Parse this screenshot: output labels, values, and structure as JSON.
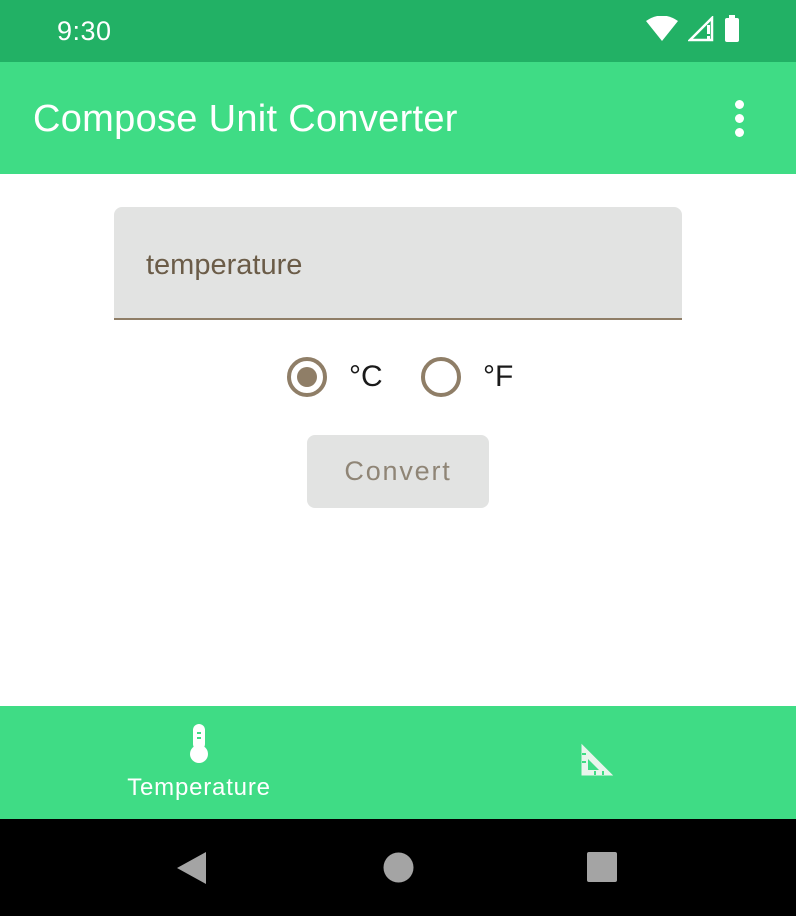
{
  "status_bar": {
    "time": "9:30",
    "icons": [
      "wifi-icon",
      "signal-icon",
      "battery-icon"
    ]
  },
  "app_bar": {
    "title": "Compose Unit Converter",
    "menu_icon": "more-vert-icon"
  },
  "form": {
    "input_placeholder": "temperature",
    "input_value": "",
    "radio_options": [
      {
        "label": "°C",
        "selected": true
      },
      {
        "label": "°F",
        "selected": false
      }
    ],
    "convert_label": "Convert"
  },
  "bottom_nav": {
    "items": [
      {
        "label": "Temperature",
        "icon": "thermometer-icon",
        "selected": true
      },
      {
        "label": "",
        "icon": "set-square-icon",
        "selected": false
      }
    ]
  },
  "system_nav": {
    "buttons": [
      "back-icon",
      "home-icon",
      "recents-icon"
    ]
  },
  "colors": {
    "status_bar": "#22b165",
    "primary": "#3fdc85",
    "accent": "#8f7e67",
    "field_bg": "#e2e3e2"
  }
}
